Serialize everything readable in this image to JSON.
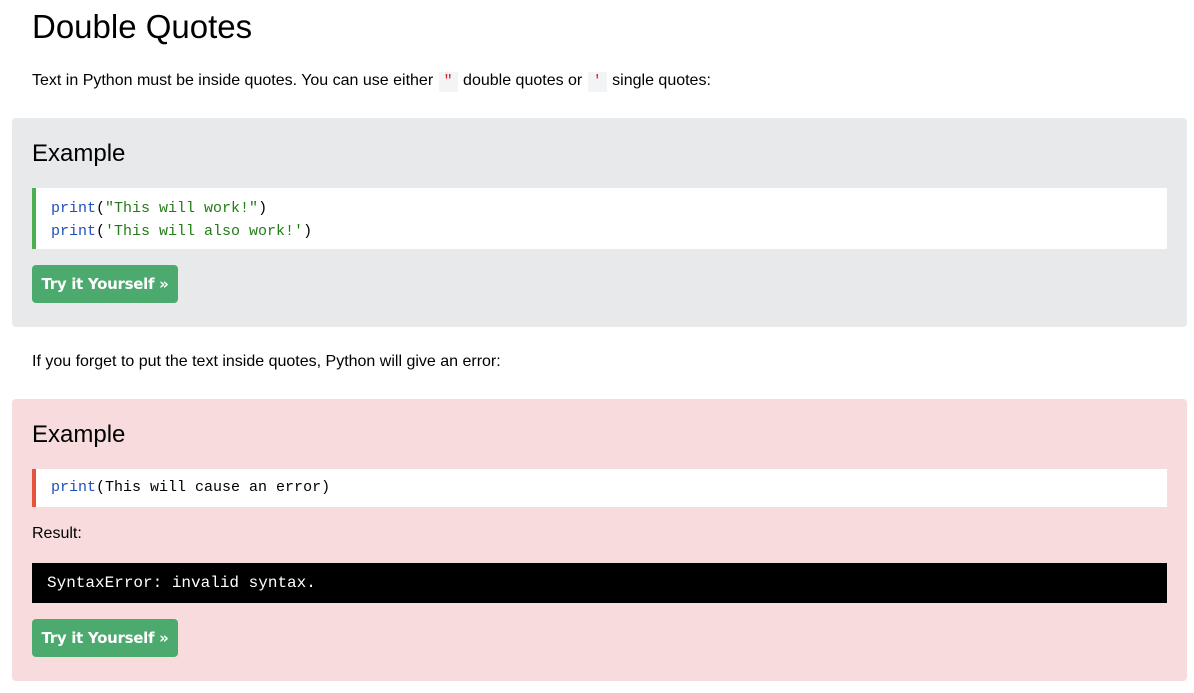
{
  "page": {
    "title": "Double Quotes",
    "intro": {
      "before": "Text in Python must be inside quotes. You can use either ",
      "code_double": "\"",
      "middle": " double quotes or ",
      "code_single": "'",
      "after": " single quotes:"
    },
    "mid_text": "If you forget to put the text inside quotes, Python will give an error:"
  },
  "example1": {
    "heading": "Example",
    "lines": [
      {
        "func": "print",
        "open": "(",
        "arg": "\"This will work!\"",
        "close": ")"
      },
      {
        "func": "print",
        "open": "(",
        "arg": "'This will also work!'",
        "close": ")"
      }
    ],
    "button_label": "Try it Yourself »"
  },
  "example2": {
    "heading": "Example",
    "line": {
      "func": "print",
      "open": "(",
      "arg": "This will cause an error",
      "close": ")"
    },
    "result_label": "Result:",
    "output": "SyntaxError: invalid syntax.",
    "button_label": "Try it Yourself »"
  },
  "colors": {
    "example_bg": "#e7e9eb",
    "error_example_bg": "#f8dcdd",
    "button": "#4caa6e",
    "code_border_ok": "#4caf50",
    "code_border_error": "#e5533d",
    "keyword": "#1f4fb8",
    "string": "#237c17"
  }
}
